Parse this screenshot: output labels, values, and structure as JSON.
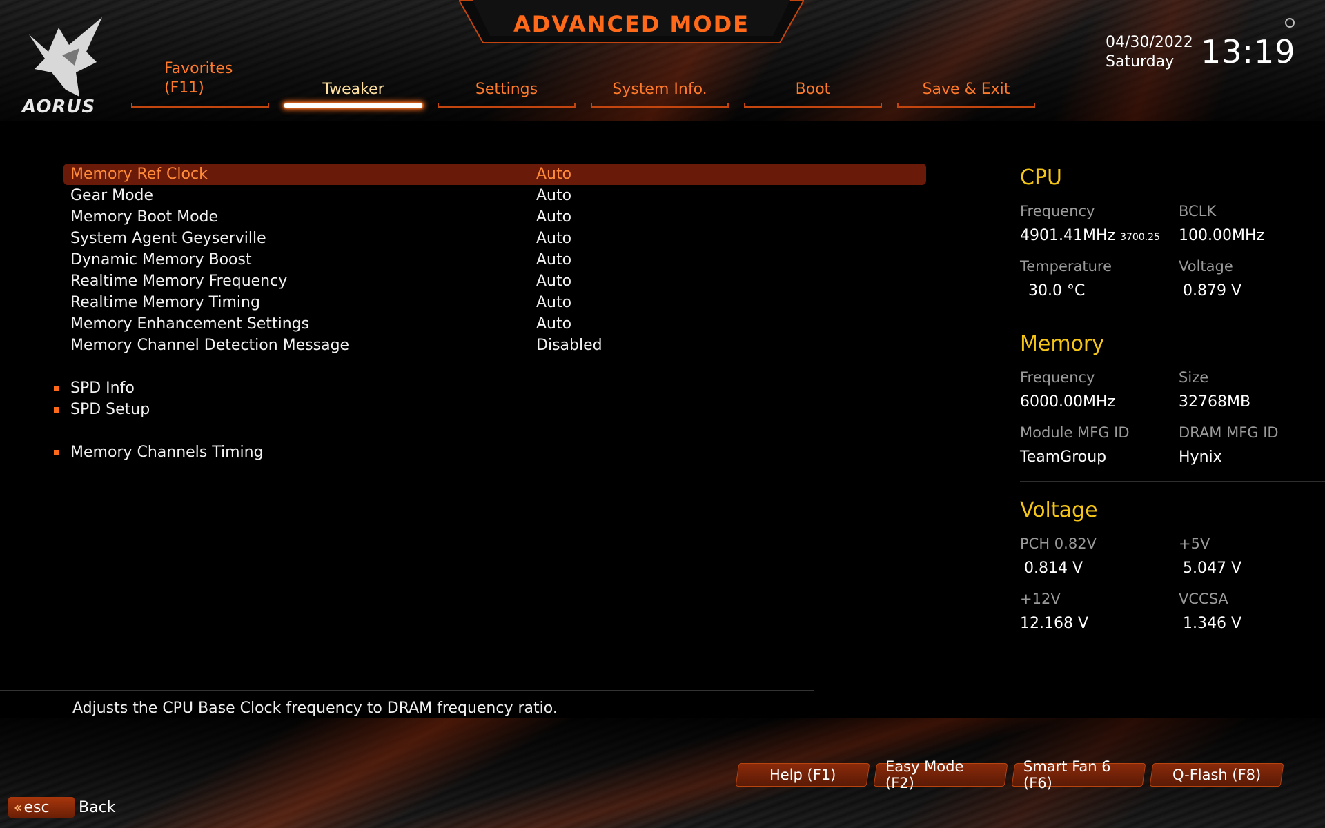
{
  "header": {
    "title": "ADVANCED MODE",
    "brand": "AORUS",
    "date": "04/30/2022",
    "day": "Saturday",
    "time": "13:19"
  },
  "tabs": [
    {
      "label_line1": "Favorites",
      "label_line2": "(F11)",
      "active": false
    },
    {
      "label": "Tweaker",
      "active": true
    },
    {
      "label": "Settings",
      "active": false
    },
    {
      "label": "System Info.",
      "active": false
    },
    {
      "label": "Boot",
      "active": false
    },
    {
      "label": "Save & Exit",
      "active": false
    }
  ],
  "settings": [
    {
      "label": "Memory Ref Clock",
      "value": "Auto",
      "selected": true
    },
    {
      "label": "Gear Mode",
      "value": "Auto"
    },
    {
      "label": "Memory Boot Mode",
      "value": "Auto"
    },
    {
      "label": "System Agent Geyserville",
      "value": "Auto"
    },
    {
      "label": "Dynamic Memory Boost",
      "value": "Auto"
    },
    {
      "label": "Realtime Memory Frequency",
      "value": "Auto"
    },
    {
      "label": "Realtime Memory Timing",
      "value": "Auto"
    },
    {
      "label": "Memory Enhancement Settings",
      "value": "Auto"
    },
    {
      "label": "Memory Channel Detection Message",
      "value": "Disabled"
    }
  ],
  "submenus": [
    {
      "label": "SPD Info"
    },
    {
      "label": "SPD Setup"
    },
    {
      "label": "Memory Channels Timing"
    }
  ],
  "description": "Adjusts the CPU Base Clock frequency to DRAM frequency ratio.",
  "panel": {
    "cpu": {
      "title": "CPU",
      "frequency_label": "Frequency",
      "frequency_value": "4901.41MHz",
      "frequency_sub": "3700.25",
      "bclk_label": "BCLK",
      "bclk_value": "100.00MHz",
      "temperature_label": "Temperature",
      "temperature_value": "30.0 °C",
      "voltage_label": "Voltage",
      "voltage_value": "0.879 V"
    },
    "memory": {
      "title": "Memory",
      "frequency_label": "Frequency",
      "frequency_value": "6000.00MHz",
      "size_label": "Size",
      "size_value": "32768MB",
      "module_mfg_label": "Module MFG ID",
      "module_mfg_value": "TeamGroup",
      "dram_mfg_label": "DRAM MFG ID",
      "dram_mfg_value": "Hynix"
    },
    "voltage": {
      "title": "Voltage",
      "pch_label": "PCH 0.82V",
      "pch_value": "0.814 V",
      "v5_label": "+5V",
      "v5_value": "5.047 V",
      "v12_label": "+12V",
      "v12_value": "12.168 V",
      "vccsa_label": "VCCSA",
      "vccsa_value": "1.346 V"
    }
  },
  "buttons": {
    "help": "Help (F1)",
    "easy_mode": "Easy Mode (F2)",
    "smart_fan": "Smart Fan 6 (F6)",
    "qflash": "Q-Flash (F8)",
    "esc": "esc",
    "back": "Back"
  },
  "colors": {
    "accent": "#ff6a1a",
    "panel_heading": "#f5c518",
    "selected_row": "#6a1a08"
  }
}
